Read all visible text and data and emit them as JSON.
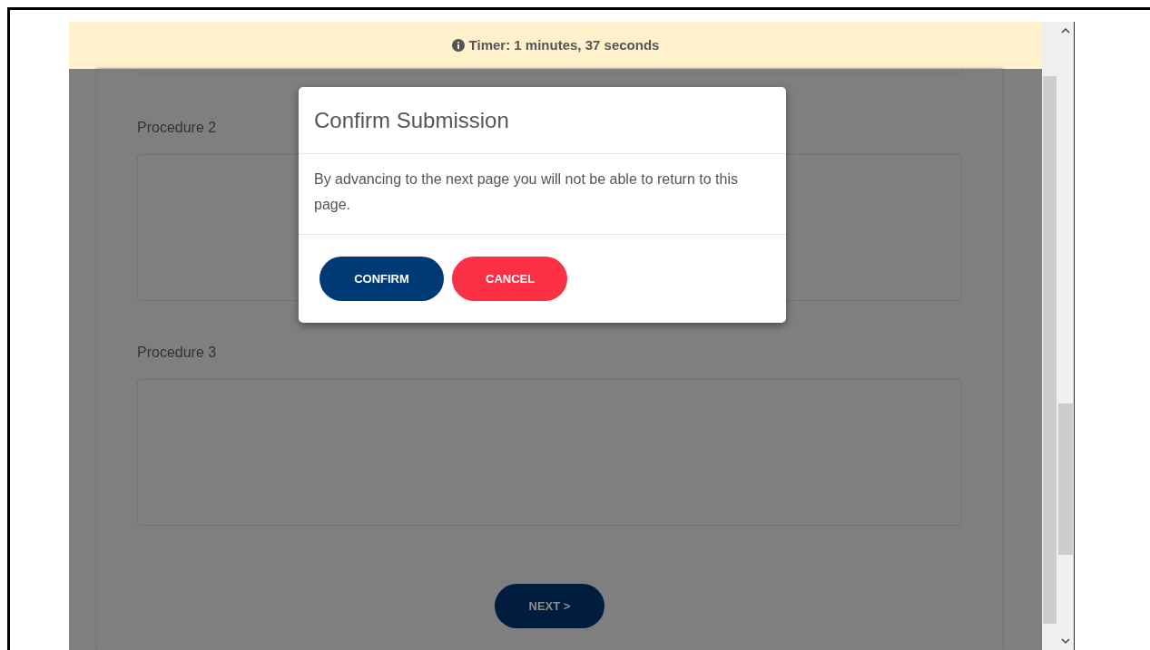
{
  "timer": {
    "text": "Timer: 1 minutes, 37 seconds"
  },
  "procedures": [
    {
      "label": "Procedure 2"
    },
    {
      "label": "Procedure 3"
    }
  ],
  "next_button": {
    "label": "NEXT >"
  },
  "modal": {
    "title": "Confirm Submission",
    "body": "By advancing to the next page you will not be able to return to this page.",
    "buttons": [
      {
        "label": "CONFIRM",
        "kind": "primary"
      },
      {
        "label": "CANCEL",
        "kind": "danger"
      }
    ]
  }
}
